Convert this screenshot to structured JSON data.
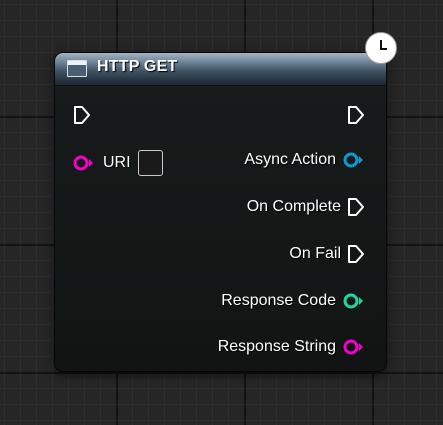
{
  "node": {
    "title": "HTTP GET",
    "header_icon": "function-icon",
    "latent_icon": "clock-icon"
  },
  "inputs": [
    {
      "label": "",
      "type": "exec"
    },
    {
      "label": "URI",
      "type": "string",
      "value": ""
    }
  ],
  "outputs": [
    {
      "label": "",
      "type": "exec"
    },
    {
      "label": "Async Action",
      "type": "object"
    },
    {
      "label": "On Complete",
      "type": "exec"
    },
    {
      "label": "On Fail",
      "type": "exec"
    },
    {
      "label": "Response Code",
      "type": "integer"
    },
    {
      "label": "Response String",
      "type": "string"
    }
  ],
  "colors": {
    "string_pin": "#f400c8",
    "object_pin": "#0a9bd4",
    "integer_pin": "#1ed6a0",
    "exec_pin": "#ffffff",
    "header": "#4a6070"
  }
}
